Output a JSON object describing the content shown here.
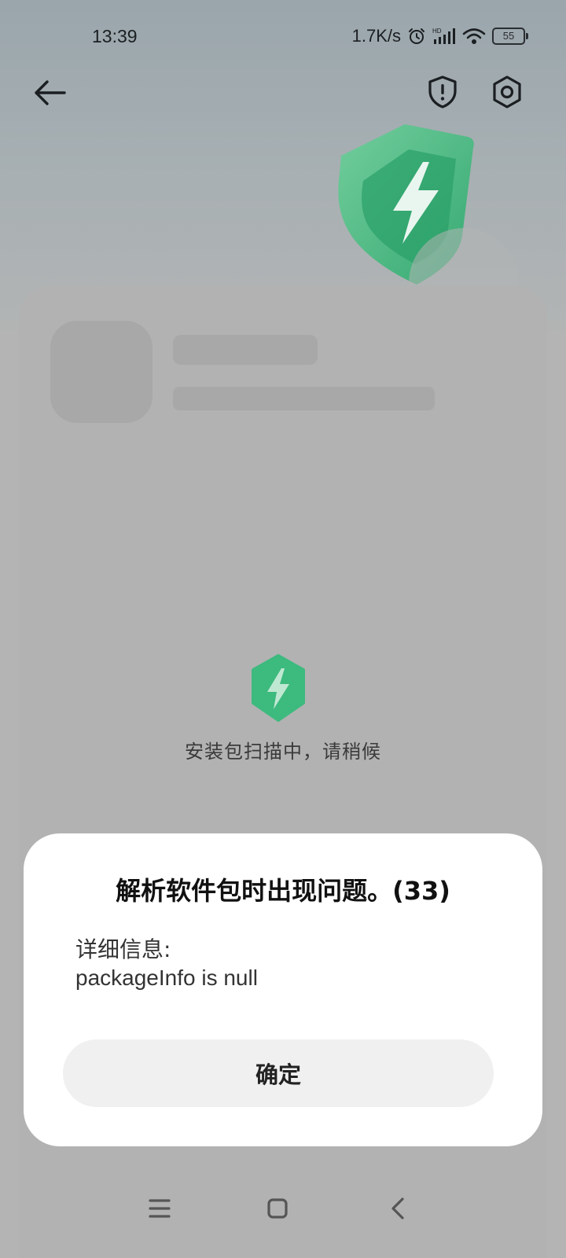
{
  "status_bar": {
    "time": "13:39",
    "net_speed": "1.7K/s",
    "signal_label": "HD",
    "battery": "55",
    "icons": [
      "alarm-icon",
      "signal-icon",
      "wifi-icon",
      "battery-icon"
    ]
  },
  "toolbar": {
    "back_icon": "arrow-left-icon",
    "shield_icon": "shield-alert-icon",
    "settings_icon": "gear-icon"
  },
  "scan": {
    "text": "安装包扫描中，请稍候"
  },
  "dialog": {
    "title": "解析软件包时出现问题。(33)",
    "detail_label": "详细信息:",
    "detail_value": "packageInfo is null",
    "ok_label": "确定"
  },
  "nav_bar": {
    "icons": [
      "menu-icon",
      "home-icon",
      "back-icon"
    ]
  },
  "colors": {
    "accent_green": "#3dba7e",
    "overlay_gray": "#b4b4b4",
    "dialog_bg": "#ffffff",
    "button_bg": "#f0f0f0"
  }
}
